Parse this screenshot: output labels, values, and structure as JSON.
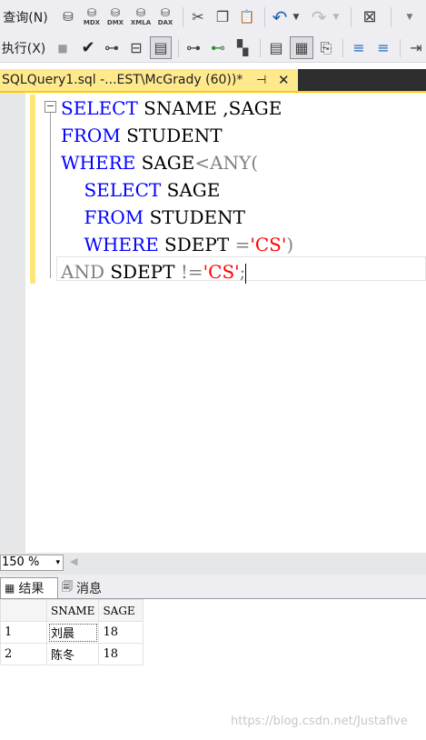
{
  "menus": {
    "query": "查询(N)",
    "execute": "执行(X)"
  },
  "toolbar1_icons": [
    {
      "name": "db-query-icon",
      "glyph": "⛁",
      "label": ""
    },
    {
      "name": "mdx-query-icon",
      "glyph": "⛁",
      "label": "MDX"
    },
    {
      "name": "dmx-query-icon",
      "glyph": "⛁",
      "label": "DMX"
    },
    {
      "name": "xmla-query-icon",
      "glyph": "⛁",
      "label": "XMLA"
    },
    {
      "name": "dax-query-icon",
      "glyph": "⛁",
      "label": "DAX"
    },
    {
      "name": "cut-icon",
      "glyph": "✂",
      "label": ""
    },
    {
      "name": "copy-icon",
      "glyph": "❐",
      "label": ""
    },
    {
      "name": "paste-icon",
      "glyph": "📋",
      "label": ""
    },
    {
      "name": "undo-icon",
      "glyph": "↶",
      "label": ""
    },
    {
      "name": "redo-icon",
      "glyph": "↷",
      "label": ""
    },
    {
      "name": "activity-monitor-icon",
      "glyph": "⊠",
      "label": ""
    }
  ],
  "toolbar2_icons": [
    {
      "name": "stop-icon",
      "glyph": "■"
    },
    {
      "name": "parse-checkmark-icon",
      "glyph": "✔"
    },
    {
      "name": "display-plan-icon",
      "glyph": "⊶"
    },
    {
      "name": "query-designer-icon",
      "glyph": "⊟"
    },
    {
      "name": "intellisense-icon",
      "glyph": "▤"
    },
    {
      "name": "include-plan-icon",
      "glyph": "⊶"
    },
    {
      "name": "live-stats-icon",
      "glyph": "⊷"
    },
    {
      "name": "client-stats-icon",
      "glyph": "▚"
    },
    {
      "name": "results-to-text-icon",
      "glyph": "▤"
    },
    {
      "name": "results-to-grid-icon",
      "glyph": "▦"
    },
    {
      "name": "results-to-file-icon",
      "glyph": "⎘"
    },
    {
      "name": "comment-icon",
      "glyph": "≡"
    },
    {
      "name": "uncomment-icon",
      "glyph": "≡"
    },
    {
      "name": "indent-icon",
      "glyph": "⇥"
    }
  ],
  "tab": {
    "title": "SQLQuery1.sql -...EST\\McGrady (60))*",
    "pin": "⊣",
    "close": "✕"
  },
  "collapse_glyph": "−",
  "code": {
    "l1": {
      "kw": "SELECT",
      "rest": " SNAME ,SAGE"
    },
    "l2": {
      "kw": "FROM",
      "rest": " STUDENT"
    },
    "l3": {
      "kw": "WHERE",
      "rest": " SAGE",
      "op": "<ANY("
    },
    "l4": {
      "indent": "    ",
      "kw": "SELECT",
      "rest": " SAGE"
    },
    "l5": {
      "indent": "    ",
      "kw": "FROM",
      "rest": " STUDENT"
    },
    "l6": {
      "indent": "    ",
      "kw": "WHERE",
      "rest": " SDEPT ",
      "op1": "=",
      "str": "'CS'",
      "op2": ")"
    },
    "l7": {
      "kw": "AND",
      "rest": " SDEPT ",
      "op1": "!=",
      "str": "'CS'",
      "op2": ";"
    }
  },
  "zoom": {
    "value": "150 %",
    "arrow": "▾",
    "scroll_left": "◀"
  },
  "results_tabs": {
    "results": "结果",
    "messages": "消息",
    "results_icon": "▦",
    "messages_icon": "🗐"
  },
  "grid": {
    "columns": [
      "",
      "SNAME",
      "SAGE"
    ],
    "rows": [
      {
        "n": "1",
        "sname": "刘晨",
        "sage": "18"
      },
      {
        "n": "2",
        "sname": "陈冬",
        "sage": "18"
      }
    ]
  },
  "watermark": "https://blog.csdn.net/Justafive",
  "colors": {
    "keyword": "#0000ff",
    "string": "#ff0000",
    "operator": "#808080",
    "tab_active": "#ffe98d",
    "change_bar": "#fde67a"
  }
}
